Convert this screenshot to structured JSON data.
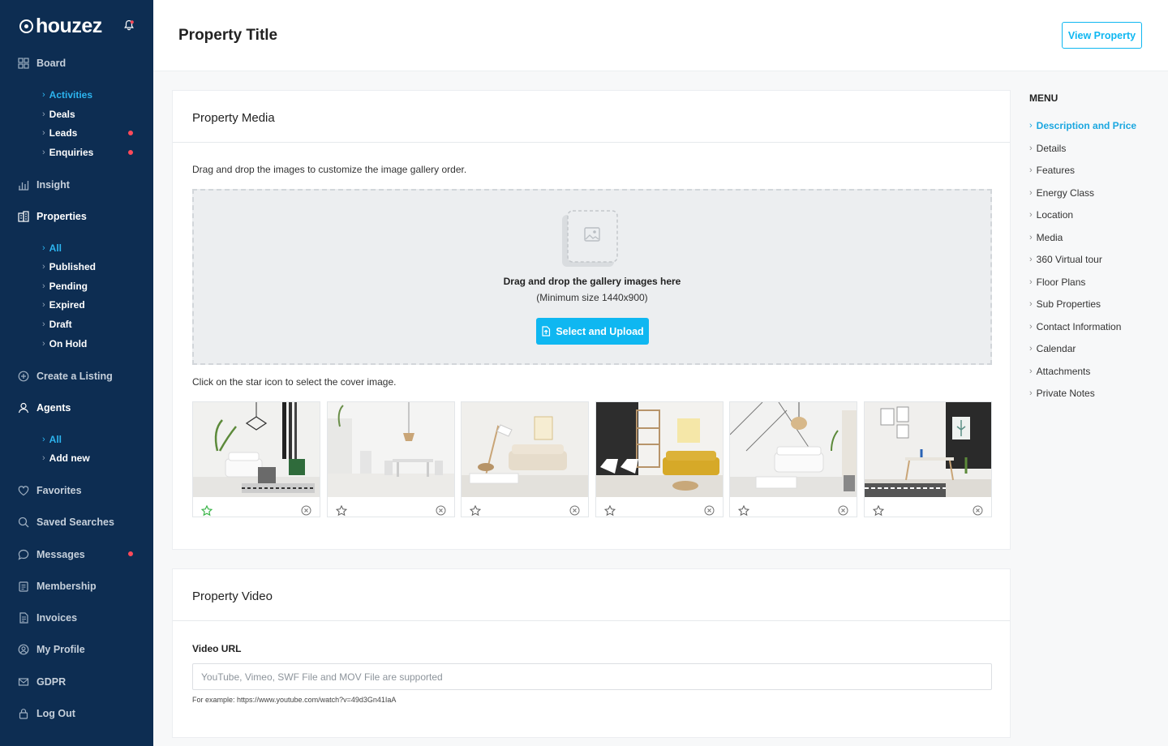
{
  "app": {
    "logo_text": "houzez"
  },
  "sidebar": {
    "board": "Board",
    "board_sub": [
      "Activities",
      "Deals",
      "Leads",
      "Enquiries"
    ],
    "insight": "Insight",
    "properties": "Properties",
    "properties_sub": [
      "All",
      "Published",
      "Pending",
      "Expired",
      "Draft",
      "On Hold"
    ],
    "create_listing": "Create a Listing",
    "agents": "Agents",
    "agents_sub": [
      "All",
      "Add new"
    ],
    "favorites": "Favorites",
    "saved_searches": "Saved Searches",
    "messages": "Messages",
    "membership": "Membership",
    "invoices": "Invoices",
    "my_profile": "My Profile",
    "gdpr": "GDPR",
    "log_out": "Log Out",
    "accent_color": "#2cb4ef",
    "notification_color": "#ff4a5a"
  },
  "header": {
    "title": "Property Title",
    "view_button": "View Property"
  },
  "media": {
    "title": "Property Media",
    "drag_hint": "Drag and drop the images to customize the image gallery order.",
    "dropzone_title": "Drag and drop the gallery images here",
    "dropzone_sub": "(Minimum size 1440x900)",
    "upload_button": "Select and Upload",
    "cover_hint": "Click on the star icon to select the cover image.",
    "images": [
      {
        "name": "living-room-green-chair",
        "cover": true
      },
      {
        "name": "dining-room-white",
        "cover": false
      },
      {
        "name": "living-room-beige-sofa",
        "cover": false
      },
      {
        "name": "dining-room-yellow-sofa",
        "cover": false
      },
      {
        "name": "living-room-white-sofa",
        "cover": false
      },
      {
        "name": "dining-room-black-wall",
        "cover": false
      }
    ]
  },
  "video": {
    "title": "Property Video",
    "label": "Video URL",
    "placeholder": "YouTube, Vimeo, SWF File and MOV File are supported",
    "example": "For example: https://www.youtube.com/watch?v=49d3Gn41IaA"
  },
  "menu": {
    "title": "MENU",
    "items": [
      "Description and Price",
      "Details",
      "Features",
      "Energy Class",
      "Location",
      "Media",
      "360 Virtual tour",
      "Floor Plans",
      "Sub Properties",
      "Contact Information",
      "Calendar",
      "Attachments",
      "Private Notes"
    ],
    "active_index": 0
  },
  "colors": {
    "primary": "#0fb7f1",
    "sidebar_bg": "#0d2d52",
    "cover_star": "#3cb54a"
  }
}
